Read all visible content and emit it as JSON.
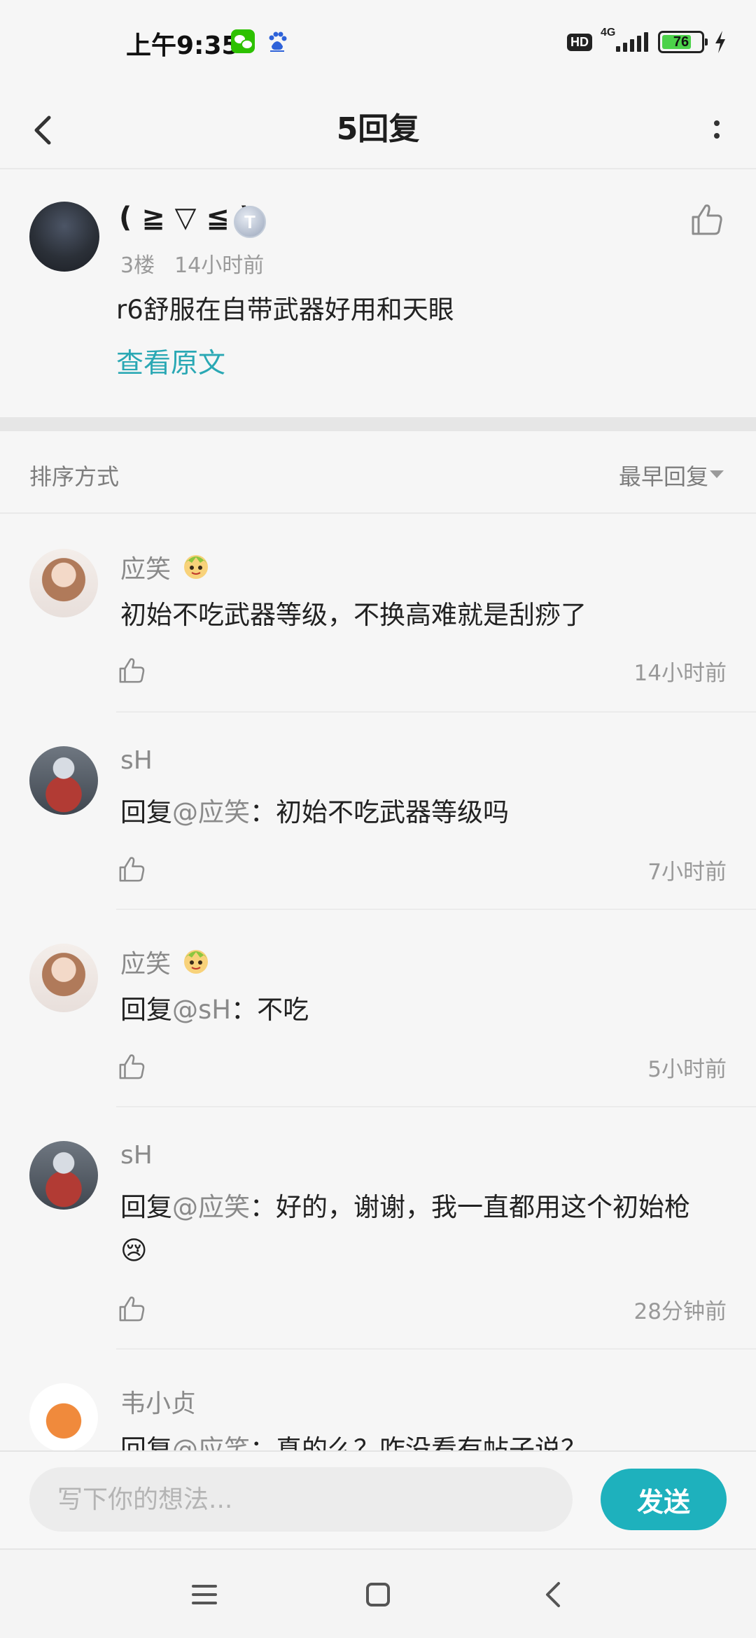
{
  "status_bar": {
    "time": "上午9:35",
    "network_label": "4G",
    "hd_label": "HD",
    "battery_level": "76",
    "battery_fraction": 0.76,
    "icons": [
      "wechat-icon",
      "baidu-icon",
      "hd-icon",
      "signal-icon",
      "battery-icon",
      "charging-icon"
    ]
  },
  "nav": {
    "title": "5回复"
  },
  "post": {
    "author": "( ≧ ▽ ≦ )",
    "badge": "T",
    "floor": "3楼",
    "time": "14小时前",
    "content": "r6舒服在自带武器好用和天眼",
    "view_original": "查看原文"
  },
  "sort": {
    "label": "排序方式",
    "value": "最早回复"
  },
  "replies": [
    {
      "name": "应笑",
      "has_emoji_badge": true,
      "reply_prefix": "",
      "reply_target": "",
      "text": "初始不吃武器等级，不换高难就是刮痧了",
      "time": "14小时前"
    },
    {
      "name": "sH",
      "has_emoji_badge": false,
      "reply_prefix": "回复",
      "reply_target": "@应笑",
      "text": "：初始不吃武器等级吗",
      "time": "7小时前"
    },
    {
      "name": "应笑",
      "has_emoji_badge": true,
      "reply_prefix": "回复",
      "reply_target": "@sH",
      "text": "：不吃",
      "time": "5小时前"
    },
    {
      "name": "sH",
      "has_emoji_badge": false,
      "reply_prefix": "回复",
      "reply_target": "@应笑",
      "text": "：好的，谢谢，我一直都用这个初始枪",
      "trailing_emoji": "😢",
      "time": "28分钟前"
    },
    {
      "name": "韦小贞",
      "has_emoji_badge": false,
      "reply_prefix": "回复",
      "reply_target": "@应笑",
      "text": "：真的么？咋没看有帖子说？",
      "time": ""
    }
  ],
  "composer": {
    "placeholder": "写下你的想法...",
    "send_label": "发送"
  },
  "colors": {
    "accent": "#1eb1bd",
    "link": "#2aa8b4",
    "background": "#f6f6f6"
  }
}
